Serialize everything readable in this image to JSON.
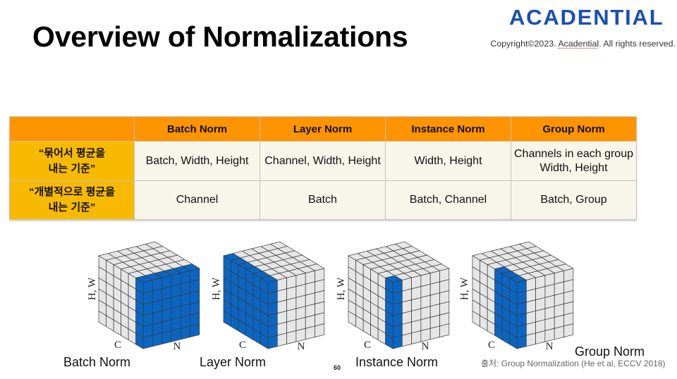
{
  "header": {
    "title": "Overview of Normalizations",
    "logo": "ACADENTIAL",
    "copyright": {
      "prefix": "Copyright©2023. ",
      "brand": "Acadential",
      "suffix": ". All rights reserved."
    }
  },
  "table": {
    "corner": "",
    "columns": [
      "Batch Norm",
      "Layer Norm",
      "Instance Norm",
      "Group Norm"
    ],
    "rows": [
      {
        "label": "“묶어서 평균을\n내는 기준”",
        "cells": [
          "Batch, Width, Height",
          "Channel, Width, Height",
          "Width, Height",
          "Channels in each group\nWidth, Height"
        ]
      },
      {
        "label": "“개별적으로 평균을\n내는 기준”",
        "cells": [
          "Channel",
          "Batch",
          "Batch, Channel",
          "Batch, Group"
        ]
      }
    ]
  },
  "figures": [
    {
      "name": "Batch Norm",
      "axes": {
        "vertical": "H, W",
        "depth": "C",
        "horizontal": "N"
      },
      "grid": {
        "n": 6,
        "c": 6,
        "hw": 6
      },
      "highlight": {
        "n": [
          0,
          5
        ],
        "c": [
          0,
          0
        ]
      }
    },
    {
      "name": "Layer Norm",
      "axes": {
        "vertical": "H, W",
        "depth": "C",
        "horizontal": "N"
      },
      "grid": {
        "n": 6,
        "c": 6,
        "hw": 6
      },
      "highlight": {
        "n": [
          0,
          0
        ],
        "c": [
          0,
          5
        ]
      }
    },
    {
      "name": "Instance Norm",
      "axes": {
        "vertical": "H, W",
        "depth": "C",
        "horizontal": "N"
      },
      "grid": {
        "n": 6,
        "c": 6,
        "hw": 6
      },
      "highlight": {
        "n": [
          0,
          0
        ],
        "c": [
          0,
          0
        ]
      }
    },
    {
      "name": "Group Norm",
      "axes": {
        "vertical": "H, W",
        "depth": "C",
        "horizontal": "N"
      },
      "grid": {
        "n": 6,
        "c": 6,
        "hw": 6
      },
      "highlight": {
        "n": [
          0,
          0
        ],
        "c": [
          0,
          2
        ]
      }
    }
  ],
  "colors": {
    "header_bg": "#FE9400",
    "row_label_bg": "#F8BA00",
    "cell_bg": "#F8F5EA",
    "logo": "#1A4FB4",
    "highlight": "#0B66C3",
    "cube_cell": "#E6E6E6",
    "cube_line": "#3A3A3A"
  },
  "footer": {
    "page_number": "60",
    "source": "출처: Group Normalization (He et al, ECCV 2018)"
  }
}
